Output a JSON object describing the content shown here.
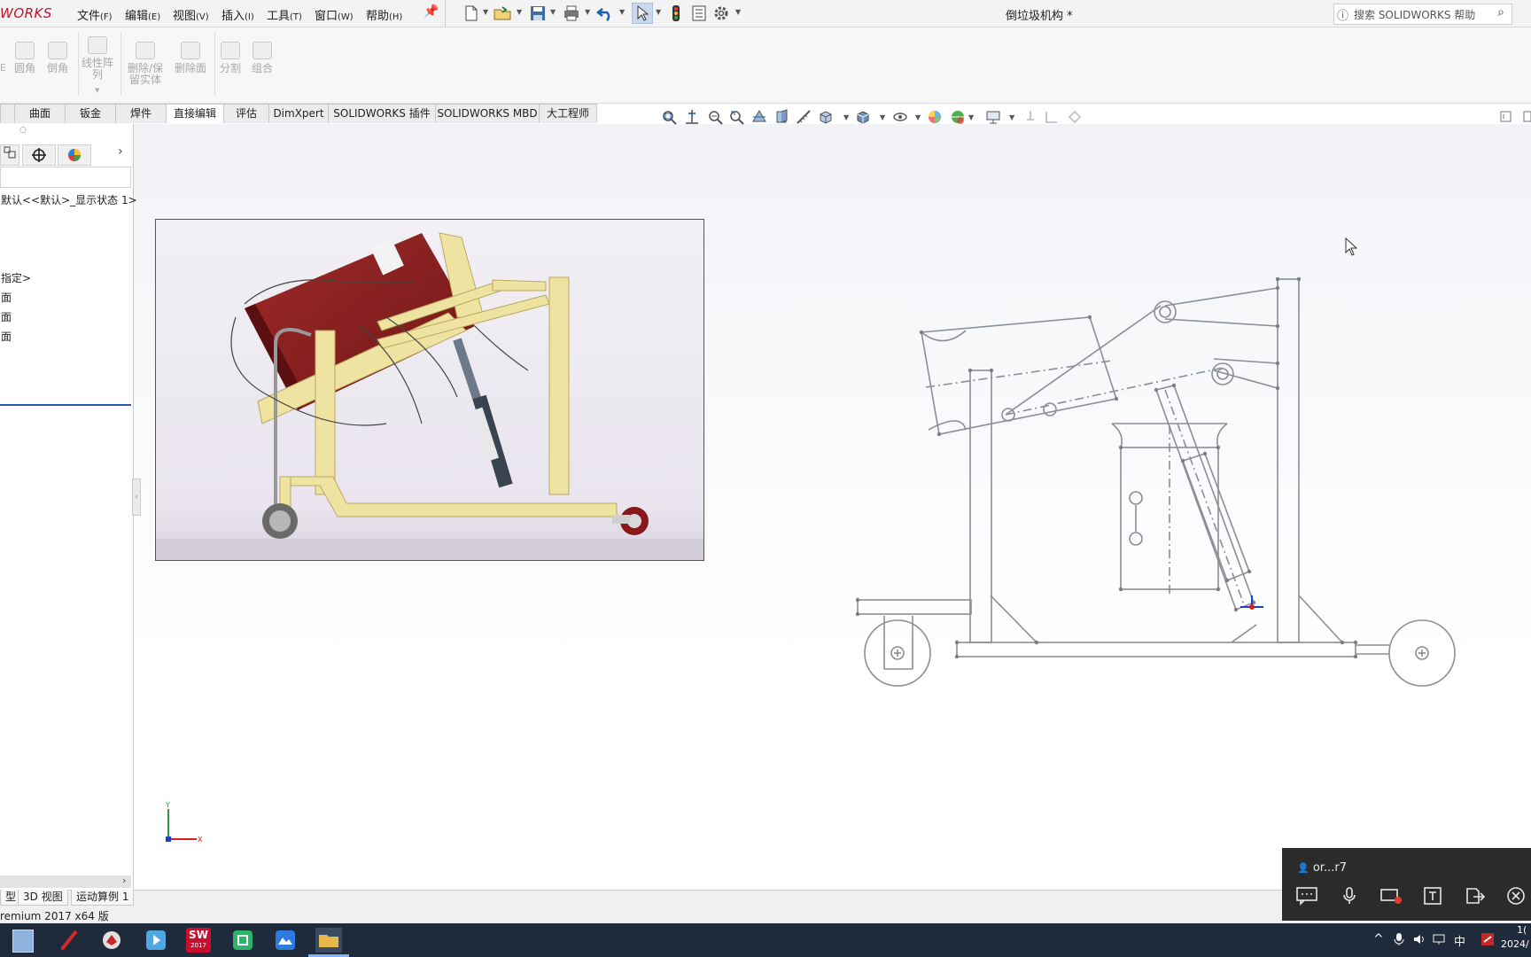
{
  "app": {
    "logo_text": "WORKS",
    "document_title": "倒垃圾机构 *",
    "brand_color": "#c8102e"
  },
  "menu": {
    "items": [
      {
        "label": "文件",
        "key": "(F)"
      },
      {
        "label": "编辑",
        "key": "(E)"
      },
      {
        "label": "视图",
        "key": "(V)"
      },
      {
        "label": "插入",
        "key": "(I)"
      },
      {
        "label": "工具",
        "key": "(T)"
      },
      {
        "label": "窗口",
        "key": "(W)"
      },
      {
        "label": "帮助",
        "key": "(H)"
      }
    ]
  },
  "search": {
    "placeholder": "搜索 SOLIDWORKS 帮助"
  },
  "ribbon": {
    "buttons": [
      {
        "label": "圆角"
      },
      {
        "label": "倒角"
      },
      {
        "label": "线性阵列"
      },
      {
        "label": "删除/保留实体"
      },
      {
        "label": "删除面"
      },
      {
        "label": "分割"
      },
      {
        "label": "组合"
      }
    ]
  },
  "tabs": {
    "items": [
      {
        "label": "曲面"
      },
      {
        "label": "钣金"
      },
      {
        "label": "焊件"
      },
      {
        "label": "直接编辑",
        "active": true
      },
      {
        "label": "评估"
      },
      {
        "label": "DimXpert"
      },
      {
        "label": "SOLIDWORKS 插件"
      },
      {
        "label": "SOLIDWORKS MBD"
      },
      {
        "label": "大工程师"
      }
    ]
  },
  "feature_tree": {
    "config": "默认<<默认>_显示状态 1>",
    "material": "指定>",
    "planes": [
      "面",
      "面",
      "面"
    ]
  },
  "bottom_tabs": {
    "items": [
      {
        "label": "型"
      },
      {
        "label": "3D 视图"
      },
      {
        "label": "运动算例 1"
      }
    ]
  },
  "status": {
    "text": "remium 2017 x64 版"
  },
  "triad": {
    "x_label": "X",
    "y_label": "Y"
  },
  "call_widget": {
    "user": "or...r7"
  },
  "taskbar": {
    "apps": [
      {
        "icon": "notepad-icon",
        "color": "#7fa7d9"
      },
      {
        "icon": "pen-app-icon",
        "color": "#d62828"
      },
      {
        "icon": "bird-app-icon",
        "color": "#d9d9d9"
      },
      {
        "icon": "media-app-icon",
        "color": "#4fa8e0"
      },
      {
        "icon": "solidworks-icon",
        "color": "#c8102e",
        "label": "SW",
        "sub": "2017"
      },
      {
        "icon": "green-app-icon",
        "color": "#2fb36b"
      },
      {
        "icon": "meeting-app-icon",
        "color": "#2d7be0"
      },
      {
        "icon": "explorer-icon",
        "color": "#e8b84a"
      }
    ],
    "tray_lang": "中",
    "clock_top": "1(",
    "clock": "2024/"
  }
}
